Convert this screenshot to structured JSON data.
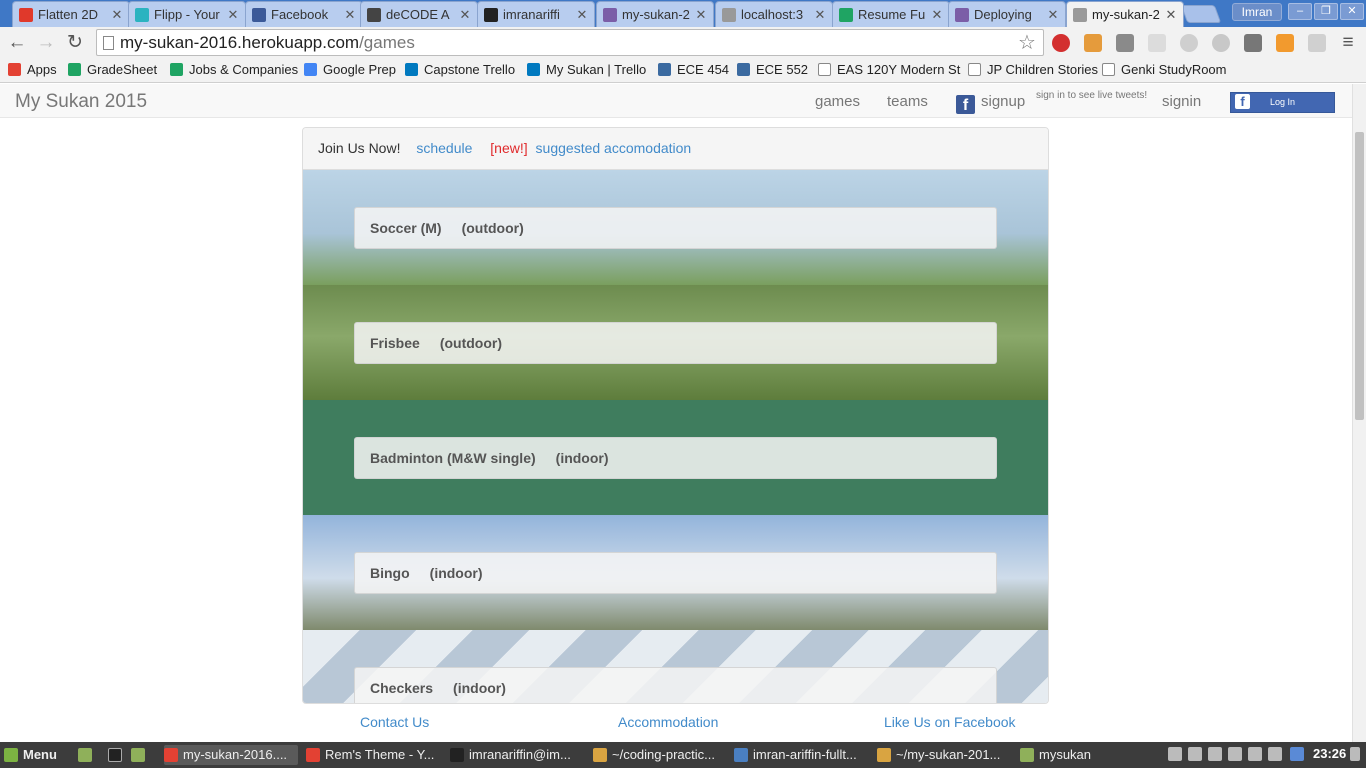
{
  "browser": {
    "tabs": [
      {
        "label": "Flatten 2D",
        "color": "#e0392b"
      },
      {
        "label": "Flipp - Your",
        "color": "#2bb3c0"
      },
      {
        "label": "Facebook",
        "color": "#3b5998"
      },
      {
        "label": "deCODE A",
        "color": "#444444"
      },
      {
        "label": "imranariffi",
        "color": "#222222"
      },
      {
        "label": "my-sukan-2",
        "color": "#7b5ea7"
      },
      {
        "label": "localhost:3",
        "color": "#999999"
      },
      {
        "label": "Resume Fu",
        "color": "#1fa463"
      },
      {
        "label": "Deploying",
        "color": "#7b5ea7"
      },
      {
        "label": "my-sukan-2",
        "color": "#999999",
        "active": true
      }
    ],
    "profile_name": "Imran",
    "url_host": "my-sukan-2016.herokuapp.com",
    "url_path": "/games",
    "bookmarks": [
      {
        "label": "Apps",
        "color": "#e34133"
      },
      {
        "label": "GradeSheet",
        "color": "#1fa463"
      },
      {
        "label": "Jobs & Companies",
        "color": "#1fa463"
      },
      {
        "label": "Google Prep",
        "color": "#4285f4"
      },
      {
        "label": "Capstone Trello",
        "color": "#0079bf"
      },
      {
        "label": "My Sukan | Trello",
        "color": "#0079bf"
      },
      {
        "label": "ECE 454",
        "color": "#3b6aa0"
      },
      {
        "label": "ECE 552",
        "color": "#3b6aa0"
      },
      {
        "label": "EAS 120Y Modern St",
        "color": "#ffffff"
      },
      {
        "label": "JP Children Stories",
        "color": "#ffffff"
      },
      {
        "label": "Genki StudyRoom",
        "color": "#ffffff"
      }
    ]
  },
  "site": {
    "brand": "My Sukan 2015",
    "nav": {
      "games": "games",
      "teams": "teams",
      "signup": "signup",
      "tweets_note": "sign in to see live tweets!",
      "signin": "signin",
      "fb_login": "Log In"
    },
    "panel": {
      "join": "Join Us Now!",
      "schedule": "schedule",
      "new_tag": "[new!]",
      "accommodation_link": "suggested accomodation"
    },
    "games": [
      {
        "name": "Soccer (M)",
        "venue": "(outdoor)"
      },
      {
        "name": "Frisbee",
        "venue": "(outdoor)"
      },
      {
        "name": "Badminton (M&W single)",
        "venue": "(indoor)"
      },
      {
        "name": "Bingo",
        "venue": "(indoor)"
      },
      {
        "name": "Checkers",
        "venue": "(indoor)"
      }
    ],
    "footer": {
      "contact": "Contact Us",
      "accommodation": "Accommodation",
      "facebook": "Like Us on Facebook"
    }
  },
  "taskbar": {
    "menu": "Menu",
    "items": [
      {
        "label": "my-sukan-2016....",
        "color": "#e34133"
      },
      {
        "label": "Rem's Theme - Y...",
        "color": "#e34133"
      },
      {
        "label": "imranariffin@im...",
        "color": "#222222"
      },
      {
        "label": "~/coding-practic...",
        "color": "#d9a441"
      },
      {
        "label": "imran-ariffin-fullt...",
        "color": "#4a7fc1"
      },
      {
        "label": "~/my-sukan-201...",
        "color": "#d9a441"
      },
      {
        "label": "mysukan",
        "color": "#8fb05a"
      }
    ],
    "clock": "23:26"
  }
}
